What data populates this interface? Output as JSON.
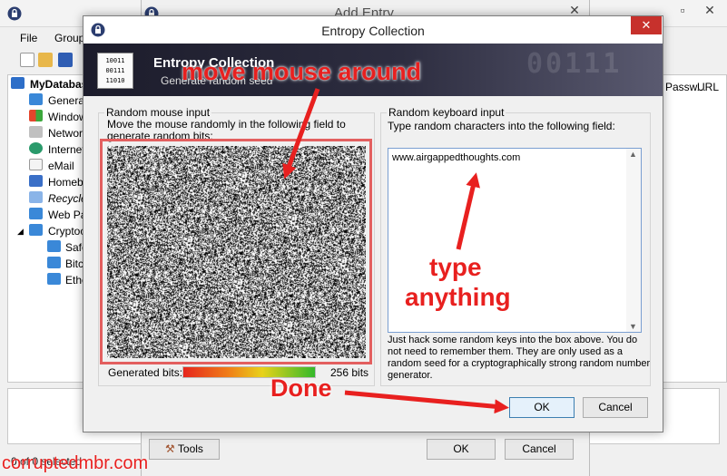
{
  "main_window": {
    "menu": [
      "File",
      "Group"
    ],
    "tree_items": [
      {
        "label": "MyDatabase",
        "icon": "database-icon"
      },
      {
        "label": "General",
        "icon": "folder-icon"
      },
      {
        "label": "Windows",
        "icon": "windows-icon"
      },
      {
        "label": "Network",
        "icon": "network-icon"
      },
      {
        "label": "Internet",
        "icon": "globe-icon"
      },
      {
        "label": "eMail",
        "icon": "email-icon"
      },
      {
        "label": "Homebanking",
        "icon": "percent-icon"
      },
      {
        "label": "Recycle Bin",
        "icon": "recycle-bin-icon"
      },
      {
        "label": "Web Pages",
        "icon": "folder-icon"
      },
      {
        "label": "Cryptocurrency",
        "icon": "folder-icon"
      },
      {
        "label": "Safe",
        "icon": "folder-icon"
      },
      {
        "label": "Bitcoin",
        "icon": "folder-icon"
      },
      {
        "label": "Ethereum",
        "icon": "folder-icon"
      }
    ],
    "list_columns": [
      "Passw...",
      "URL"
    ],
    "status": "0 of 0 selected"
  },
  "add_entry": {
    "title": "Add Entry",
    "tools_label": "Tools",
    "ok_label": "OK",
    "cancel_label": "Cancel"
  },
  "entropy_dialog": {
    "title": "Entropy Collection",
    "banner_title": "Entropy Collection",
    "banner_subtitle": "Generate random seed",
    "banner_bits": "00111",
    "icon_rows": [
      "10011",
      "00111",
      "11010"
    ],
    "mouse_group_label": "Random mouse input",
    "mouse_description": "Move the mouse randomly in the following field to generate random bits:",
    "generated_bits_label": "Generated bits:",
    "generated_bits_value": "256 bits",
    "bits_progress_fraction": 1.0,
    "keyboard_group_label": "Random keyboard input",
    "keyboard_description": "Type random characters into the following field:",
    "keyboard_value": "www.airgappedthoughts.com",
    "keyboard_help": "Just hack some random keys into the box above. You do not need to remember them. They are only used as a random seed for a cryptographically strong random number generator.",
    "ok_label": "OK",
    "cancel_label": "Cancel"
  },
  "annotations": {
    "move": "move mouse around",
    "type_line1": "type",
    "type_line2": "anything",
    "done": "Done",
    "watermark": "corruptedmbr.com"
  },
  "colors": {
    "annotation": "#e8201f",
    "close_button": "#c7312c",
    "ok_focus": "#3c7fb1"
  }
}
